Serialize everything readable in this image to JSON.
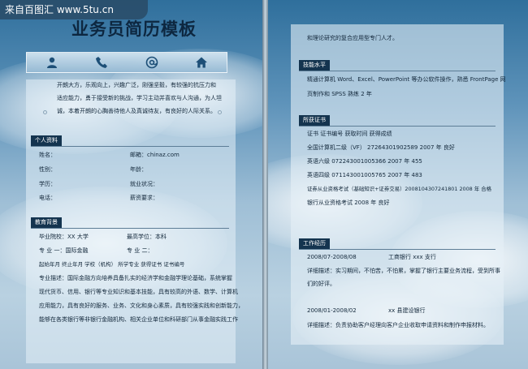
{
  "watermark": "来自百图汇 www.5tu.cn",
  "title": "业务员简历模板",
  "icons": [
    "person-icon",
    "phone-icon",
    "at-icon",
    "home-icon"
  ],
  "intro": [
    "开朗大方，乐观向上，兴趣广泛，刚强坚毅，有较强的抗压力和",
    "适应能力，勇于接受新的挑战，学习主动并喜欢与人沟通，为人坦",
    "诚，本着开朗的心胸善待他人及真诚待友，有良好的人际关系。"
  ],
  "personal": {
    "heading": "个人资料",
    "name_label": "姓名：",
    "email_label": "邮箱：chinaz.com",
    "gender_label": "性别：",
    "age_label": "年龄：",
    "edu_label": "学历：",
    "status_label": "就业状况：",
    "phone_label": "电话：",
    "salary_label": "薪资要求："
  },
  "education": {
    "heading": "教育背景",
    "school": "毕业院校：XX 大学",
    "degree": "最高学位：本科",
    "major1": "专  业  一：国际金融",
    "major2": "专  业  二：",
    "table_header": "起始年月      终止年月      学校（机构）    所学专业          获得证书          证书编号",
    "desc": [
      "专业描述：国际金融方向培养具备扎实的经济学和金融学理论基础，系统掌握",
      "现代货币、信用、银行等专业知识和基本技能，具有较高的外语、数学、计算机",
      "应用能力，具有良好的服务、业务、文化和身心素质，具有较强实践和创新能力，",
      "能够在各类银行等非银行金融机构、相关企业单位和科研部门从事金融实践工作"
    ]
  },
  "right": {
    "top_line": "和理论研究的复合应用型专门人才。",
    "skills_heading": "技能水平",
    "skills": [
      "精通计算机 Word、Excel、PowerPoint 等办公软件操作，熟悉 FrontPage 网",
      "页制作和 SPSS 熟练 2 年"
    ],
    "certs_heading": "所获证书",
    "certs_header": "证书  证书编号  获取时间  获得成绩",
    "certs": [
      "全国计算机二级（VF）  27264301902589 2007 年 良好",
      "英语六级 072243001005366 2007 年 455",
      "英语四级 071143001005765 2007 年 483",
      "证券从业资格考试（基础知识+证券交易）2008104307241801 2008 年 合格",
      "银行从业资格考试 2008 年 良好"
    ],
    "work_heading": "工作经历",
    "work": [
      {
        "period": "2008/07-2008/08",
        "company": "工商银行 xxx 支行",
        "detail": "详细描述：实习期间，不怕苦，不怕累，掌握了银行主要业务流程，受到所事",
        "detail2": "们的好评。"
      },
      {
        "period": "2008/01-2008/02",
        "company": "xx 县建设银行",
        "detail": "详细描述：负责协助客户经理向客户企业收取申请资料和制作申报材料。",
        "detail2": ""
      }
    ]
  }
}
